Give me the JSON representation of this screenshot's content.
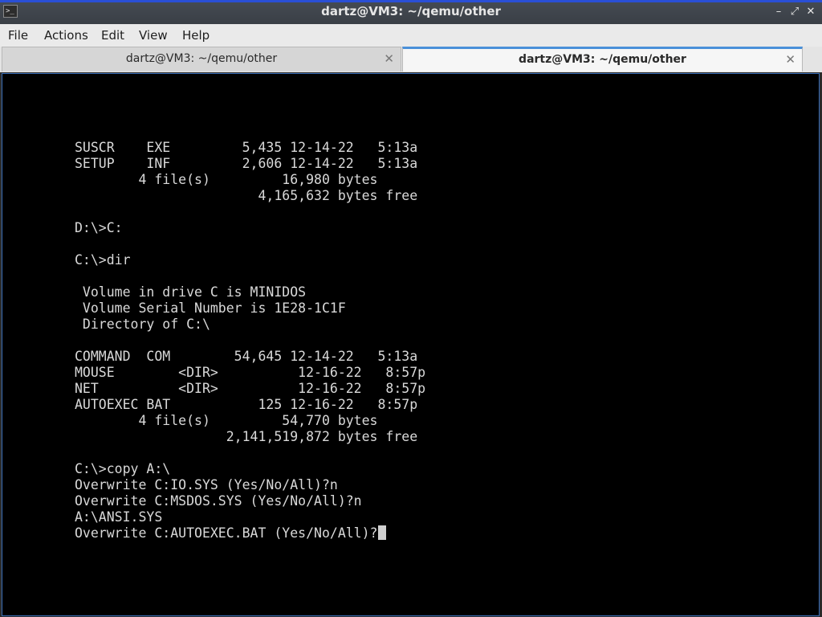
{
  "window": {
    "title": "dartz@VM3: ~/qemu/other",
    "app_icon": ">_",
    "minimize_glyph": "–",
    "maximize_glyph": "⤢",
    "close_glyph": "✕"
  },
  "menu": {
    "file": "File",
    "actions": "Actions",
    "edit": "Edit",
    "view": "View",
    "help": "Help"
  },
  "tabs": [
    {
      "label": "dartz@VM3: ~/qemu/other",
      "active": false
    },
    {
      "label": "dartz@VM3: ~/qemu/other",
      "active": true
    }
  ],
  "terminal": {
    "output": "SUSCR    EXE         5,435 12-14-22   5:13a\nSETUP    INF         2,606 12-14-22   5:13a\n        4 file(s)         16,980 bytes\n                       4,165,632 bytes free\n\nD:\\>C:\n\nC:\\>dir\n\n Volume in drive C is MINIDOS\n Volume Serial Number is 1E28-1C1F\n Directory of C:\\\n\nCOMMAND  COM        54,645 12-14-22   5:13a\nMOUSE        <DIR>          12-16-22   8:57p\nNET          <DIR>          12-16-22   8:57p\nAUTOEXEC BAT           125 12-16-22   8:57p\n        4 file(s)         54,770 bytes\n                   2,141,519,872 bytes free\n\nC:\\>copy A:\\\nOverwrite C:IO.SYS (Yes/No/All)?n\nOverwrite C:MSDOS.SYS (Yes/No/All)?n\nA:\\ANSI.SYS",
    "prompt_line": "Overwrite C:AUTOEXEC.BAT (Yes/No/All)?"
  },
  "colors": {
    "terminal_bg": "#000000",
    "terminal_fg": "#d9d9d9",
    "active_tab_accent": "#4a90d9",
    "titlebar_accent": "#2a4fd6"
  }
}
